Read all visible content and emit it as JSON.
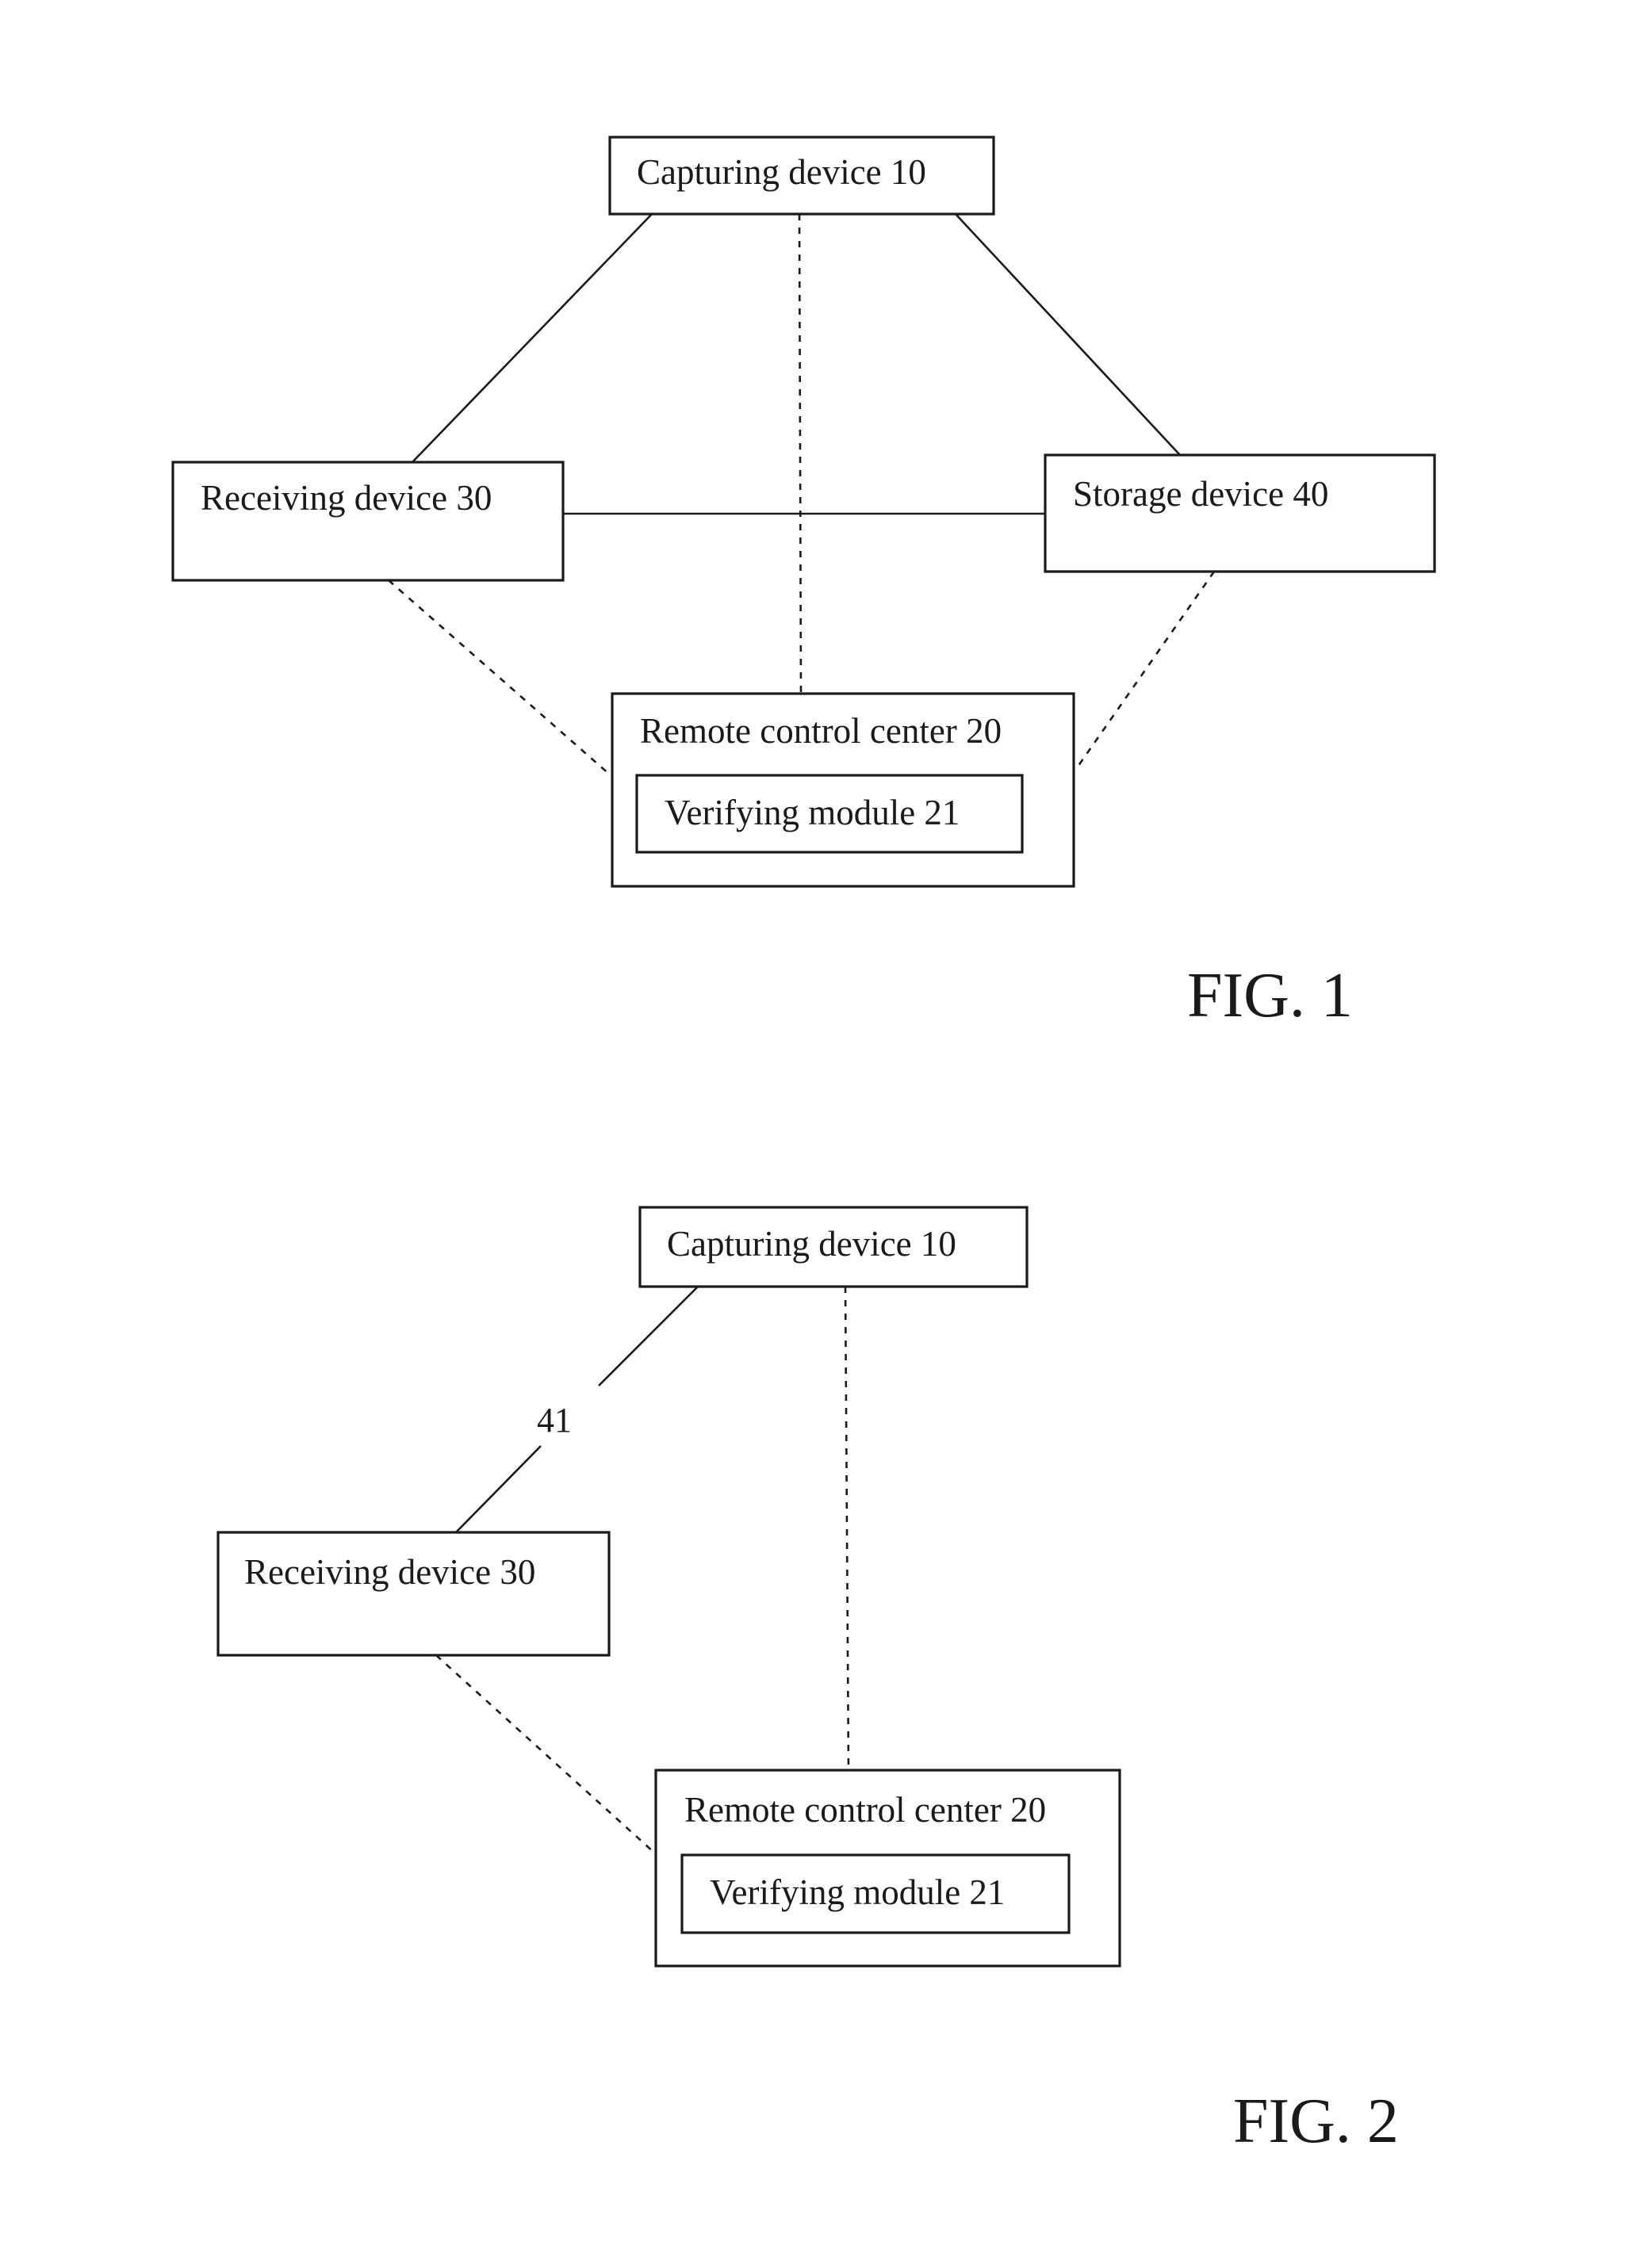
{
  "figures": [
    {
      "caption": "FIG. 1",
      "nodes": {
        "capturing": "Capturing device 10",
        "receiving": "Receiving device 30",
        "storage": "Storage device 40",
        "remote": "Remote control center 20",
        "verifying": "Verifying module 21"
      },
      "edges": [
        {
          "from": "capturing",
          "to": "receiving",
          "style": "solid"
        },
        {
          "from": "capturing",
          "to": "storage",
          "style": "solid"
        },
        {
          "from": "receiving",
          "to": "storage",
          "style": "solid"
        },
        {
          "from": "capturing",
          "to": "remote",
          "style": "dashed"
        },
        {
          "from": "receiving",
          "to": "remote",
          "style": "dashed"
        },
        {
          "from": "storage",
          "to": "remote",
          "style": "dashed"
        }
      ]
    },
    {
      "caption": "FIG. 2",
      "nodes": {
        "capturing": "Capturing device 10",
        "receiving": "Receiving device 30",
        "remote": "Remote control center 20",
        "verifying": "Verifying module 21"
      },
      "link_label": "41",
      "edges": [
        {
          "from": "capturing",
          "to": "receiving",
          "style": "solid",
          "label": "41"
        },
        {
          "from": "capturing",
          "to": "remote",
          "style": "dashed"
        },
        {
          "from": "receiving",
          "to": "remote",
          "style": "dashed"
        }
      ]
    }
  ]
}
